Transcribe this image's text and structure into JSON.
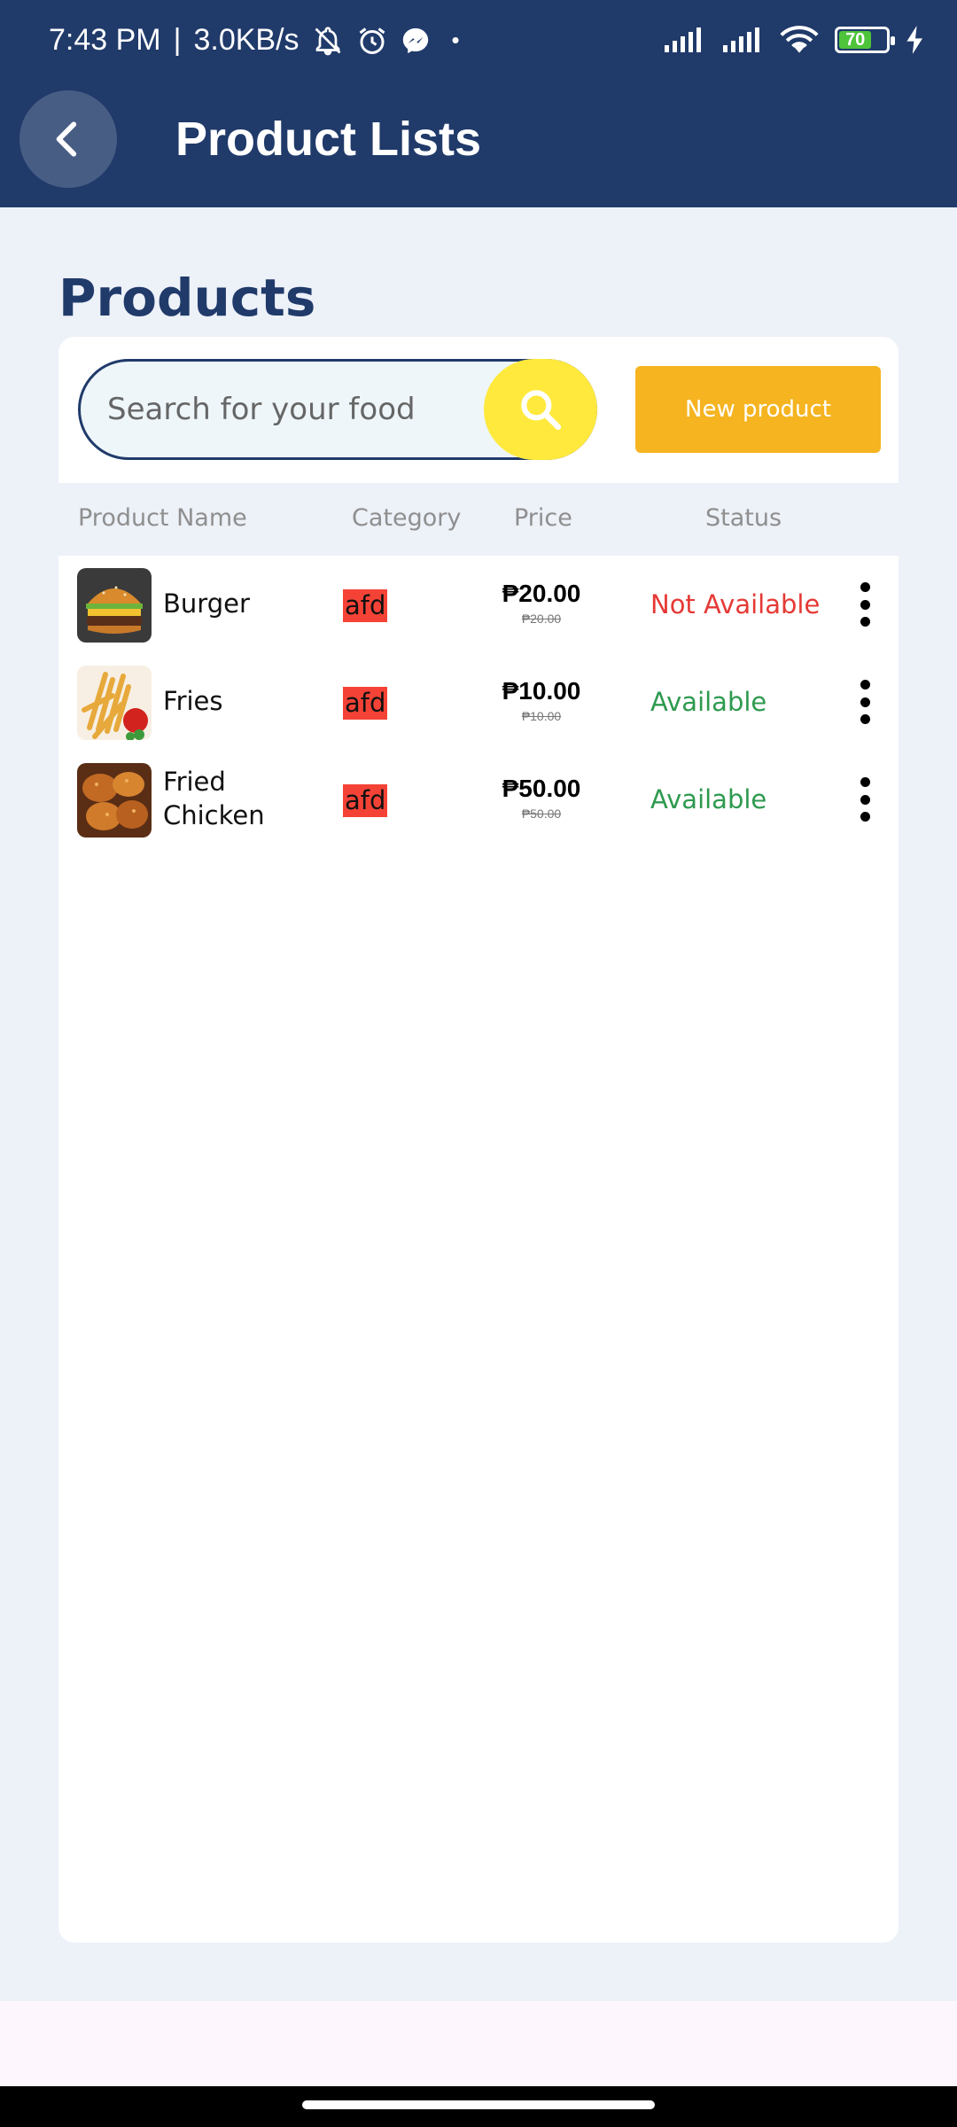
{
  "status_bar": {
    "time": "7:43 PM",
    "speed": "3.0KB/s",
    "battery_level": "70",
    "icons": [
      "bell-off-icon",
      "alarm-icon",
      "messenger-icon",
      "dot-icon",
      "signal-icon",
      "signal-icon",
      "wifi-icon",
      "battery-icon",
      "charging-icon"
    ]
  },
  "appbar": {
    "title": "Product Lists",
    "back_icon": "chevron-left-icon"
  },
  "section": {
    "title": "Products"
  },
  "search": {
    "placeholder": "Search for your food",
    "value": "",
    "button_icon": "search-icon"
  },
  "new_product_label": "New product",
  "table": {
    "headers": {
      "name": "Product Name",
      "category": "Category",
      "price": "Price",
      "status": "Status"
    },
    "rows": [
      {
        "name_line1": "Burger",
        "name_line2": "",
        "category": "afd",
        "price": "₱20.00",
        "original_price": "₱20.00",
        "status": "Not Available",
        "status_color": "#e53935",
        "image": "burger"
      },
      {
        "name_line1": "Fries",
        "name_line2": "",
        "category": "afd",
        "price": "₱10.00",
        "original_price": "₱10.00",
        "status": "Available",
        "status_color": "#2e9a4f",
        "image": "fries"
      },
      {
        "name_line1": "Fried",
        "name_line2": "Chicken",
        "category": "afd",
        "price": "₱50.00",
        "original_price": "₱50.00",
        "status": "Available",
        "status_color": "#2e9a4f",
        "image": "fried-chicken"
      }
    ]
  },
  "colors": {
    "primary": "#203a6a",
    "accent_yellow": "#ffe93d",
    "button_orange": "#f5b420",
    "category_badge": "#f44336"
  }
}
